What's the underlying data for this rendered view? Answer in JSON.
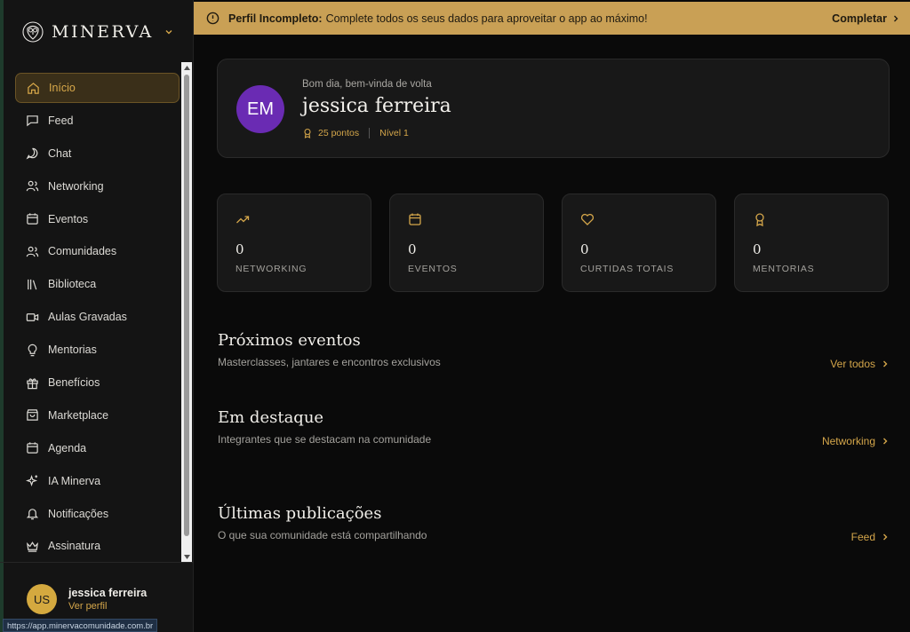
{
  "brand": {
    "name": "MINERVA"
  },
  "nav": [
    {
      "label": "Início",
      "icon": "home-icon",
      "active": true
    },
    {
      "label": "Feed",
      "icon": "message-square-icon"
    },
    {
      "label": "Chat",
      "icon": "chat-bubble-icon"
    },
    {
      "label": "Networking",
      "icon": "users-icon"
    },
    {
      "label": "Eventos",
      "icon": "calendar-icon"
    },
    {
      "label": "Comunidades",
      "icon": "users-icon"
    },
    {
      "label": "Biblioteca",
      "icon": "library-icon"
    },
    {
      "label": "Aulas Gravadas",
      "icon": "video-icon"
    },
    {
      "label": "Mentorias",
      "icon": "lightbulb-icon"
    },
    {
      "label": "Benefícios",
      "icon": "gift-icon"
    },
    {
      "label": "Marketplace",
      "icon": "shopping-bag-icon"
    },
    {
      "label": "Agenda",
      "icon": "calendar-icon"
    },
    {
      "label": "IA Minerva",
      "icon": "sparkles-icon"
    },
    {
      "label": "Notificações",
      "icon": "bell-icon"
    },
    {
      "label": "Assinatura",
      "icon": "crown-icon"
    }
  ],
  "user": {
    "initials": "US",
    "name": "jessica ferreira",
    "link": "Ver perfil"
  },
  "status_url": "https://app.minervacomunidade.com.br",
  "banner": {
    "title": "Perfil Incompleto:",
    "message": "Complete todos os seus dados para aproveitar o app ao máximo!",
    "action": "Completar"
  },
  "welcome": {
    "initials": "EM",
    "greeting": "Bom dia, bem-vinda de volta",
    "name": "jessica ferreira",
    "points": "25 pontos",
    "level": "Nível 1"
  },
  "stats": [
    {
      "value": "0",
      "label": "NETWORKING",
      "icon": "trending-up-icon"
    },
    {
      "value": "0",
      "label": "EVENTOS",
      "icon": "calendar-icon"
    },
    {
      "value": "0",
      "label": "CURTIDAS TOTAIS",
      "icon": "heart-icon"
    },
    {
      "value": "0",
      "label": "MENTORIAS",
      "icon": "award-icon"
    }
  ],
  "sections": [
    {
      "title": "Próximos eventos",
      "subtitle": "Masterclasses, jantares e encontros exclusivos",
      "link": "Ver todos"
    },
    {
      "title": "Em destaque",
      "subtitle": "Integrantes que se destacam na comunidade",
      "link": "Networking"
    },
    {
      "title": "Últimas publicações",
      "subtitle": "O que sua comunidade está compartilhando",
      "link": "Feed"
    }
  ],
  "colors": {
    "accent": "#d4a64a",
    "banner": "#c9a055",
    "avatar": "#6a2bb3",
    "user_avatar": "#d4a93f"
  }
}
